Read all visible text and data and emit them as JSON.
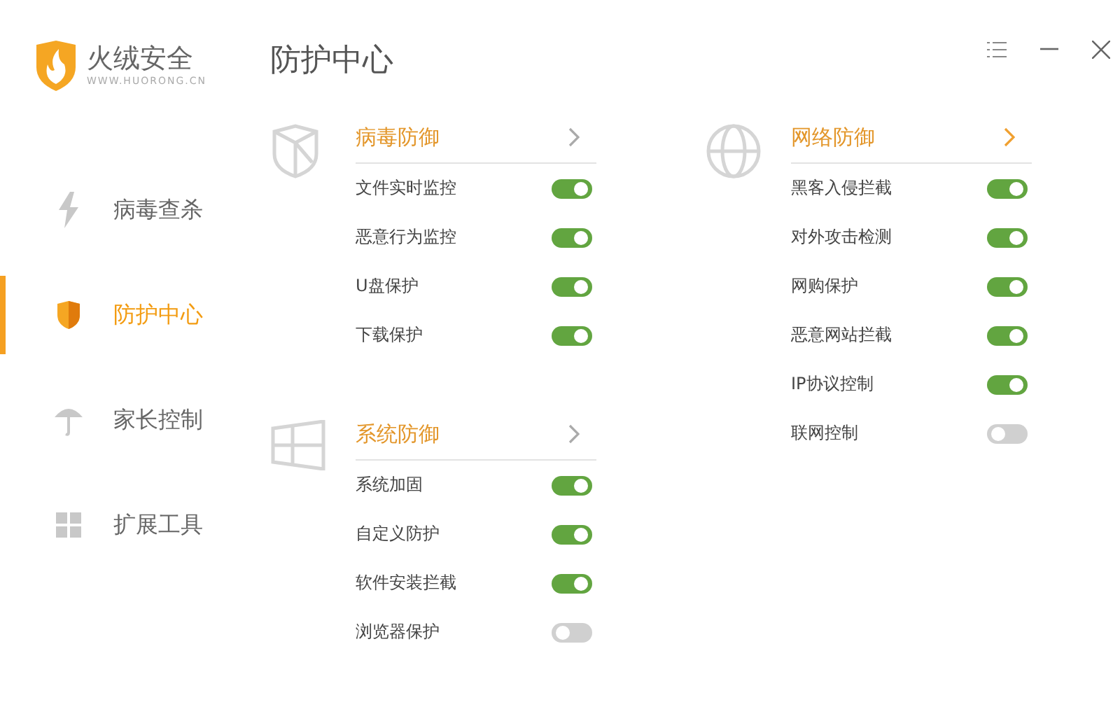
{
  "logo": {
    "name": "火绒安全",
    "url": "WWW.HUORONG.CN"
  },
  "sidebar": {
    "items": [
      {
        "label": "病毒查杀",
        "selected": false
      },
      {
        "label": "防护中心",
        "selected": true
      },
      {
        "label": "家长控制",
        "selected": false
      },
      {
        "label": "扩展工具",
        "selected": false
      }
    ]
  },
  "page_title": "防护中心",
  "columns": [
    [
      {
        "title": "病毒防御",
        "arrow_highlighted": false,
        "items": [
          {
            "label": "文件实时监控",
            "on": true
          },
          {
            "label": "恶意行为监控",
            "on": true
          },
          {
            "label": "U盘保护",
            "on": true
          },
          {
            "label": "下载保护",
            "on": true
          }
        ]
      },
      {
        "title": "系统防御",
        "arrow_highlighted": false,
        "items": [
          {
            "label": "系统加固",
            "on": true
          },
          {
            "label": "自定义防护",
            "on": true
          },
          {
            "label": "软件安装拦截",
            "on": true
          },
          {
            "label": "浏览器保护",
            "on": false
          }
        ]
      }
    ],
    [
      {
        "title": "网络防御",
        "arrow_highlighted": true,
        "items": [
          {
            "label": "黑客入侵拦截",
            "on": true
          },
          {
            "label": "对外攻击检测",
            "on": true
          },
          {
            "label": "网购保护",
            "on": true
          },
          {
            "label": "恶意网站拦截",
            "on": true
          },
          {
            "label": "IP协议控制",
            "on": true
          },
          {
            "label": "联网控制",
            "on": false
          }
        ]
      }
    ]
  ]
}
